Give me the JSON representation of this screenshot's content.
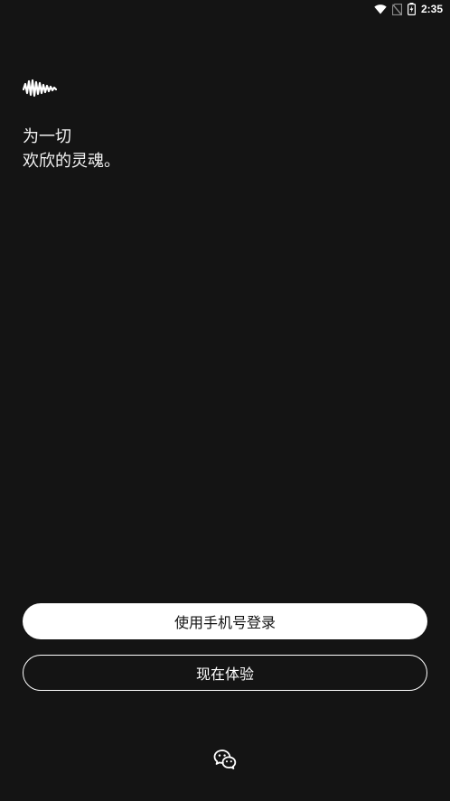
{
  "status_bar": {
    "time": "2:35",
    "icons": [
      "wifi-icon",
      "no-sim-icon",
      "battery-charging-icon"
    ]
  },
  "logo": {
    "icon": "waveform-logo-icon"
  },
  "slogan": {
    "line1": "为一切",
    "line2": "欢欣的灵魂。"
  },
  "actions": {
    "phone_login_label": "使用手机号登录",
    "try_now_label": "现在体验"
  },
  "social_login": {
    "icon": "wechat-icon"
  },
  "colors": {
    "background": "#141414",
    "primary_button": "#ffffff",
    "text": "#ffffff"
  }
}
